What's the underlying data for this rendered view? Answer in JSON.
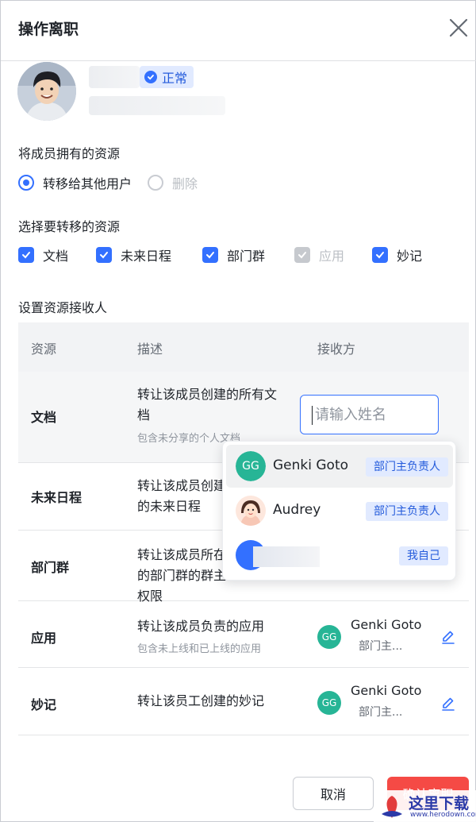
{
  "dialog": {
    "title": "操作离职",
    "close_icon": "close-icon"
  },
  "member": {
    "status": "正常"
  },
  "ownership": {
    "label": "将成员拥有的资源",
    "options": [
      {
        "label": "转移给其他用户",
        "selected": true,
        "disabled": false
      },
      {
        "label": "删除",
        "selected": false,
        "disabled": true
      }
    ]
  },
  "resources_select": {
    "label": "选择要转移的资源",
    "items": [
      {
        "label": "文档",
        "checked": true,
        "disabled": false
      },
      {
        "label": "未来日程",
        "checked": true,
        "disabled": false
      },
      {
        "label": "部门群",
        "checked": true,
        "disabled": false
      },
      {
        "label": "应用",
        "checked": true,
        "disabled": true
      },
      {
        "label": "妙记",
        "checked": true,
        "disabled": false
      }
    ]
  },
  "receiver": {
    "label": "设置资源接收人",
    "columns": [
      "资源",
      "描述",
      "接收方"
    ],
    "rows": [
      {
        "resource": "文档",
        "desc": "转让该成员创建的所有文档",
        "note": "包含未分享的个人文档",
        "input_placeholder": "请输入姓名"
      },
      {
        "resource": "未来日程",
        "desc": "转让该成员创建的未来日程"
      },
      {
        "resource": "部门群",
        "desc": "转让该成员所在的部门群的群主权限"
      },
      {
        "resource": "应用",
        "desc": "转让该成员负责的应用",
        "note": "包含未上线和已上线的应用",
        "receiver_name": "Genki Goto",
        "receiver_role": "部门主...",
        "avatar_initials": "GG"
      },
      {
        "resource": "妙记",
        "desc": "转让该员工创建的妙记",
        "receiver_name": "Genki Goto",
        "receiver_role": "部门主...",
        "avatar_initials": "GG"
      }
    ]
  },
  "dropdown": {
    "items": [
      {
        "name": "Genki Goto",
        "tag": "部门主负责人",
        "avatar_initials": "GG"
      },
      {
        "name": "Audrey",
        "tag": "部门主负责人"
      },
      {
        "name": "",
        "tag": "我自己"
      }
    ]
  },
  "footer": {
    "cancel": "取消",
    "confirm": "确认离职"
  },
  "watermark": {
    "text": "这里下载",
    "url": "www.herodown.com"
  },
  "colors": {
    "primary": "#3370ff",
    "danger": "#f54a45",
    "avatar_green": "#27b596"
  }
}
